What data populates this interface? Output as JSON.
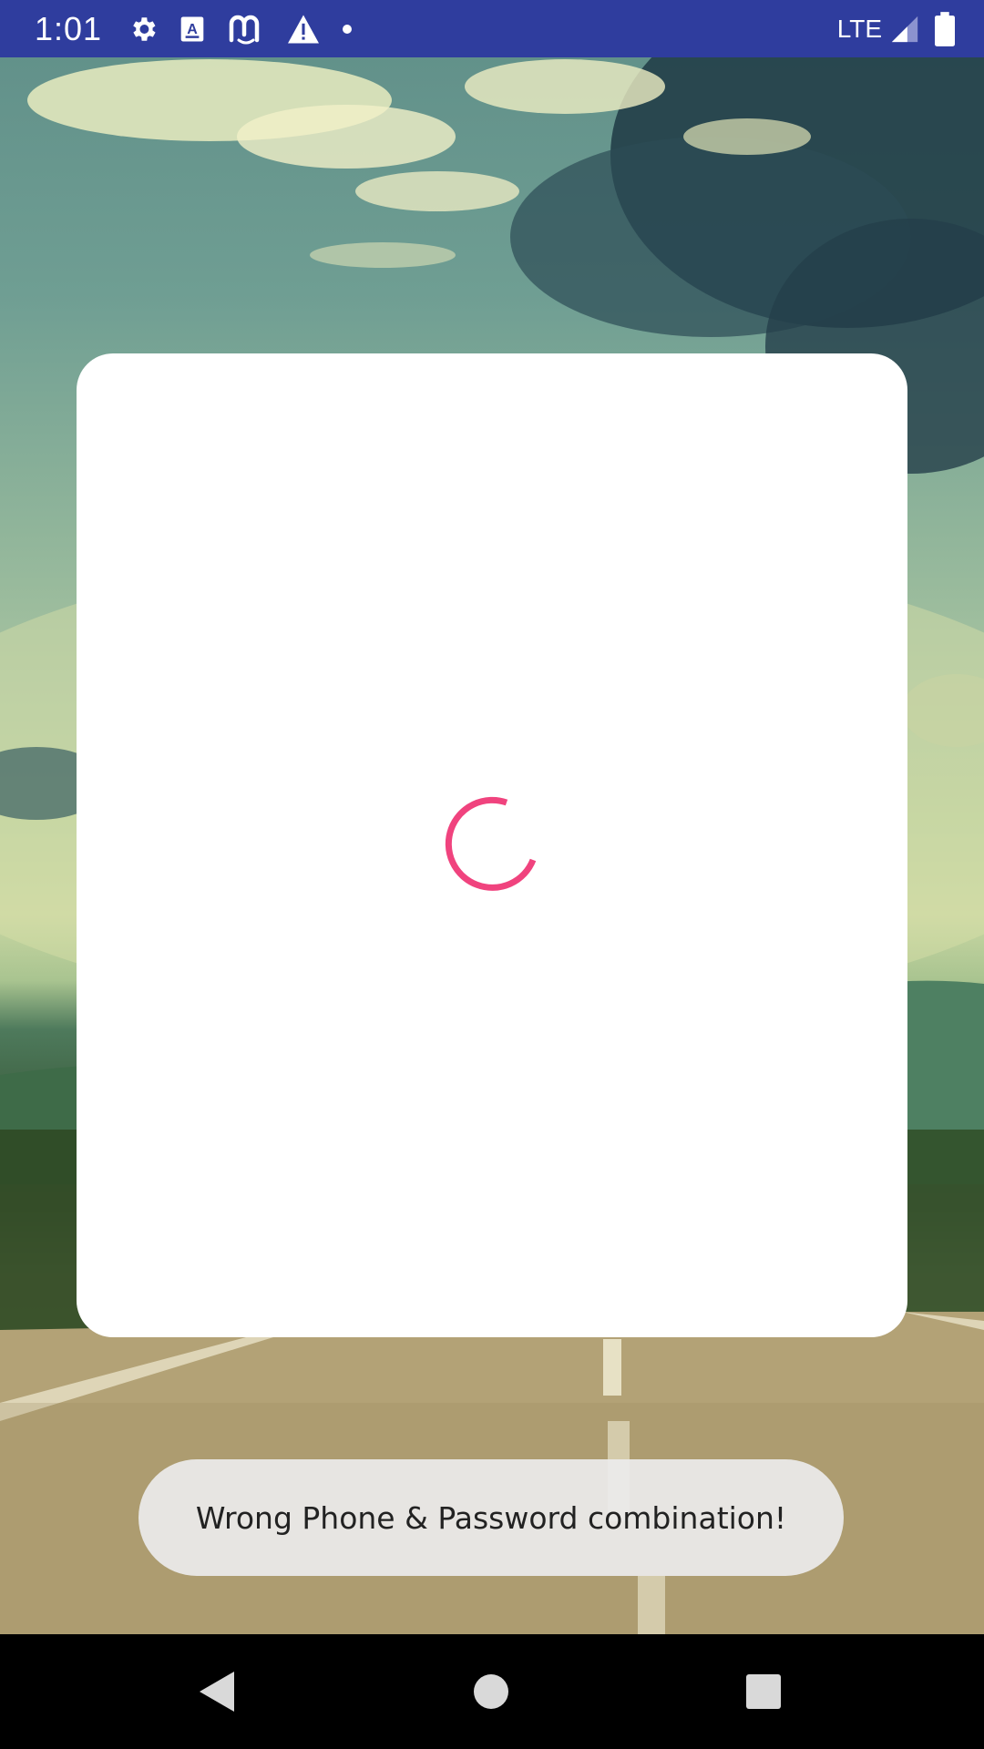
{
  "status_bar": {
    "time": "1:01",
    "network": "LTE",
    "icons_left": [
      "gear-icon",
      "font-a-icon",
      "app-m-icon",
      "warning-icon",
      "dot-icon"
    ],
    "icons_right": [
      "signal-icon",
      "battery-icon"
    ],
    "color": "#2f3d9e"
  },
  "dialog": {
    "state": "loading",
    "spinner_color": "#f0437e"
  },
  "toast": {
    "message": "Wrong Phone & Password combination!"
  },
  "nav_bar": {
    "buttons": [
      "back-icon",
      "home-icon",
      "recents-icon"
    ]
  }
}
